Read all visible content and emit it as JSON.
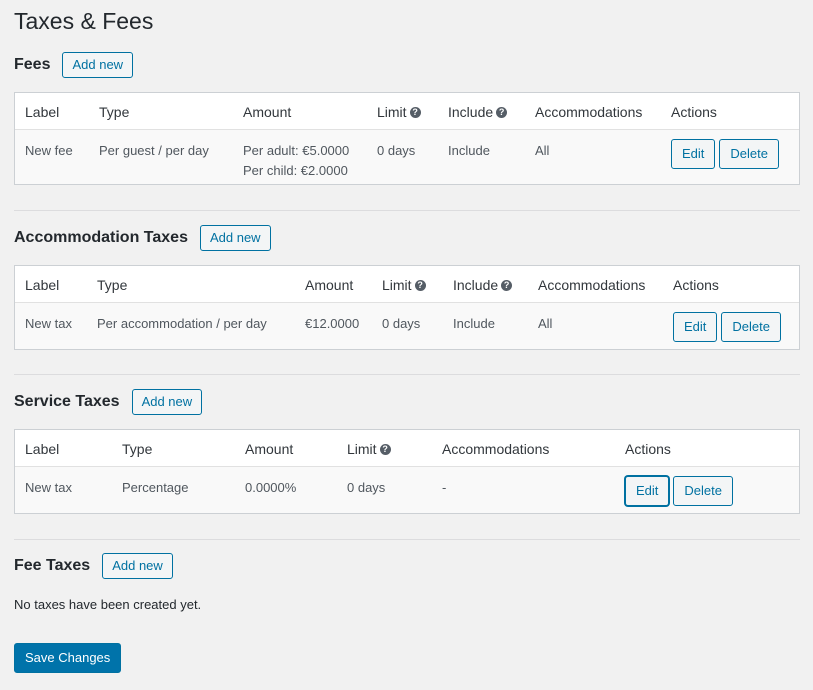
{
  "page": {
    "title": "Taxes & Fees"
  },
  "help_glyph": "?",
  "fees": {
    "heading": "Fees",
    "add_label": "Add new",
    "columns": [
      "Label",
      "Type",
      "Amount",
      "Limit",
      "Include",
      "Accommodations",
      "Actions"
    ],
    "rows": [
      {
        "label": "New fee",
        "type": "Per guest / per day",
        "amount_adult": "Per adult: €5.0000",
        "amount_child": "Per child: €2.0000",
        "limit": "0 days",
        "include": "Include",
        "accommodations": "All",
        "edit_label": "Edit",
        "delete_label": "Delete"
      }
    ]
  },
  "accommodation_taxes": {
    "heading": "Accommodation Taxes",
    "add_label": "Add new",
    "columns": [
      "Label",
      "Type",
      "Amount",
      "Limit",
      "Include",
      "Accommodations",
      "Actions"
    ],
    "rows": [
      {
        "label": "New tax",
        "type": "Per accommodation / per day",
        "amount": "€12.0000",
        "limit": "0 days",
        "include": "Include",
        "accommodations": "All",
        "edit_label": "Edit",
        "delete_label": "Delete"
      }
    ]
  },
  "service_taxes": {
    "heading": "Service Taxes",
    "add_label": "Add new",
    "columns": [
      "Label",
      "Type",
      "Amount",
      "Limit",
      "Accommodations",
      "Actions"
    ],
    "rows": [
      {
        "label": "New tax",
        "type": "Percentage",
        "amount": "0.0000%",
        "limit": "0 days",
        "accommodations": "-",
        "edit_label": "Edit",
        "delete_label": "Delete"
      }
    ]
  },
  "fee_taxes": {
    "heading": "Fee Taxes",
    "add_label": "Add new",
    "empty_message": "No taxes have been created yet."
  },
  "save_label": "Save Changes",
  "colors": {
    "accent": "#0071a1",
    "primary_button": "#0073aa",
    "background": "#f1f1f1"
  }
}
